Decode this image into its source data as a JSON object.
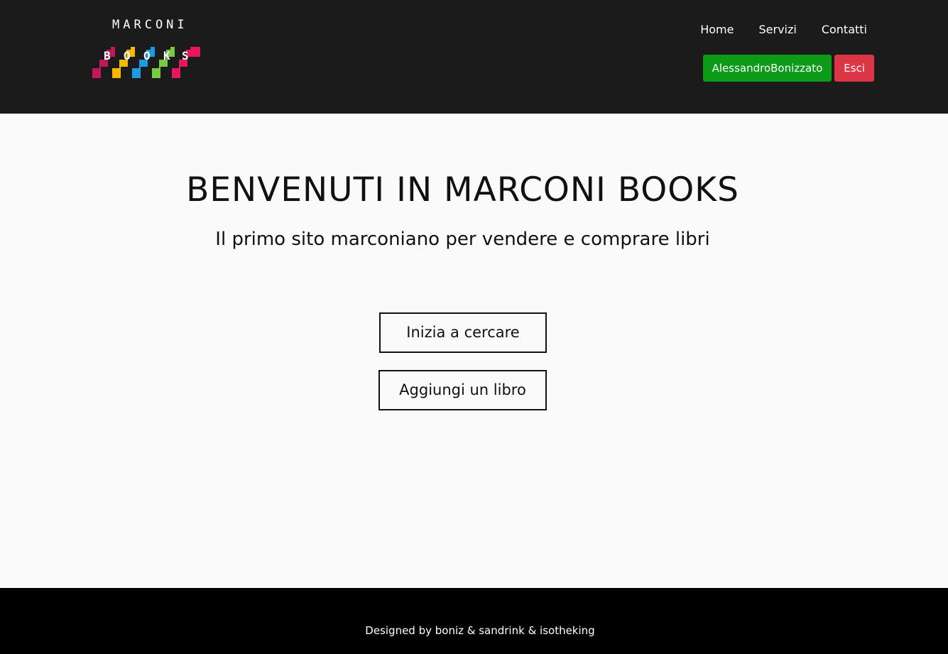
{
  "brand": {
    "logo_top": "MARCONI",
    "logo_bottom": [
      "B",
      "O",
      "O",
      "K",
      "S"
    ],
    "logo_colors": [
      "#c2185b",
      "#f5b800",
      "#1e9be0",
      "#7ac943",
      "#e8175d"
    ]
  },
  "nav": {
    "items": [
      {
        "label": "Home"
      },
      {
        "label": "Servizi"
      },
      {
        "label": "Contatti"
      }
    ]
  },
  "user": {
    "username": "AlessandroBonizzato",
    "logout_label": "Esci",
    "username_color": "#0c9a19",
    "logout_color": "#dc3545"
  },
  "hero": {
    "title": "BENVENUTI IN MARCONI BOOKS",
    "subtitle": "Il primo sito marconiano per vendere e comprare libri",
    "search_button": "Inizia a cercare",
    "add_button": "Aggiungi un libro"
  },
  "footer": {
    "credits": "Designed by boniz & sandrink & isotheking"
  }
}
